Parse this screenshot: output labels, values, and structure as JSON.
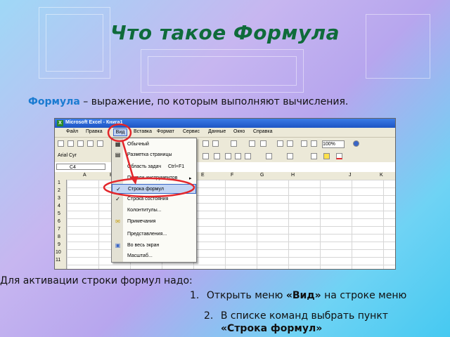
{
  "slide": {
    "title": "Что такое Формула",
    "definition_term": "Формула",
    "definition_rest": " – выражение, по  которым выполняют вычисления.",
    "activation_text": "Для активации строки формул надо:",
    "step1_num": "1.",
    "step1_pre": "Открыть меню ",
    "step1_bold": "«Вид»",
    "step1_post": " на строке меню",
    "step2_num": "2.",
    "step2_pre": "В списке команд выбрать пункт",
    "step2_bold": "«Строка формул»"
  },
  "excel": {
    "window_title": "Microsoft Excel - Книга1",
    "menu": [
      "Файл",
      "Правка",
      "Вид",
      "Вставка",
      "Формат",
      "Сервис",
      "Данные",
      "Окно",
      "Справка"
    ],
    "font_name": "Arial Cyr",
    "zoom": "100%",
    "cell_ref": "C4",
    "columns": [
      "A",
      "B",
      "E",
      "F",
      "G",
      "H",
      "J",
      "K"
    ],
    "rows": [
      "1",
      "2",
      "3",
      "4",
      "5",
      "6",
      "7",
      "8",
      "9",
      "10",
      "11"
    ],
    "view_menu": [
      {
        "label": "Обычный",
        "shortcut": ""
      },
      {
        "label": "Разметка страницы",
        "shortcut": ""
      },
      {
        "label": "Область задач",
        "shortcut": "Ctrl+F1"
      },
      {
        "label": "Панели инструментов",
        "shortcut": "▸"
      },
      {
        "label": "Строка формул",
        "shortcut": ""
      },
      {
        "label": "Строка состояния",
        "shortcut": ""
      },
      {
        "label": "Колонтитулы...",
        "shortcut": ""
      },
      {
        "label": "Примечания",
        "shortcut": ""
      },
      {
        "label": "Представления...",
        "shortcut": ""
      },
      {
        "label": "Во весь экран",
        "shortcut": ""
      },
      {
        "label": "Масштаб...",
        "shortcut": ""
      }
    ]
  },
  "colors": {
    "title": "#0f6b3a",
    "term": "#1a7bd1",
    "annotation": "#e3262b"
  }
}
